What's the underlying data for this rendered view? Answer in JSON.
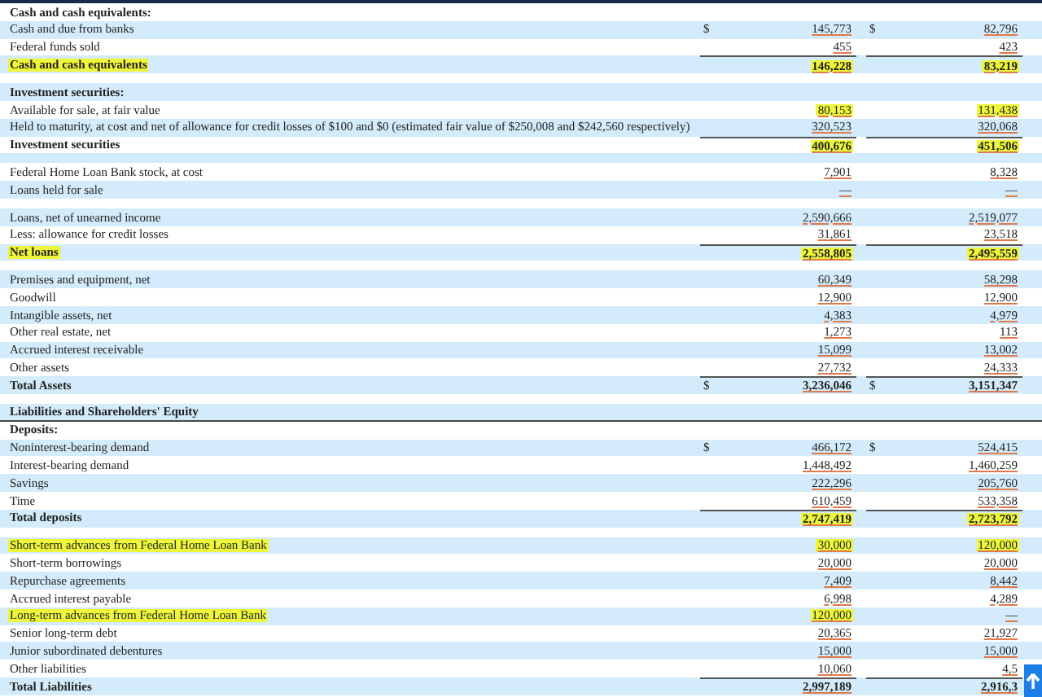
{
  "rows": [
    {
      "kind": "heading",
      "label": "Cash and cash equivalents:",
      "highlight": false
    },
    {
      "kind": "item",
      "label": "Cash and due from banks",
      "highlight": false,
      "col_1": {
        "dollar": "$",
        "value": "145,773",
        "highlight": false
      },
      "col_2": {
        "dollar": "$",
        "value": "82,796",
        "highlight": false
      }
    },
    {
      "kind": "item",
      "label": "Federal funds sold",
      "highlight": false,
      "col_1": {
        "value": "455",
        "highlight": false
      },
      "col_2": {
        "value": "423",
        "highlight": false
      }
    },
    {
      "kind": "total",
      "label": "Cash and cash equivalents",
      "highlight": true,
      "col_1": {
        "value": "146,228",
        "highlight": true
      },
      "col_2": {
        "value": "83,219",
        "highlight": true
      }
    },
    {
      "kind": "spacer"
    },
    {
      "kind": "heading",
      "label": "Investment securities:",
      "highlight": false
    },
    {
      "kind": "item",
      "label": "Available for sale, at fair value",
      "highlight": false,
      "col_1": {
        "value": "80,153",
        "highlight": true
      },
      "col_2": {
        "value": "131,438",
        "highlight": true
      }
    },
    {
      "kind": "item",
      "label": "Held to maturity, at cost and net of allowance for credit losses of $100 and $0 (estimated fair value of $250,008 and $242,560 respectively)",
      "highlight": false,
      "col_1": {
        "value": "320,523",
        "highlight": false
      },
      "col_2": {
        "value": "320,068",
        "highlight": false
      }
    },
    {
      "kind": "total",
      "label": "Investment securities",
      "highlight": false,
      "col_1": {
        "value": "400,676",
        "highlight": true
      },
      "col_2": {
        "value": "451,506",
        "highlight": true
      }
    },
    {
      "kind": "spacer"
    },
    {
      "kind": "item",
      "label": "Federal Home Loan Bank stock, at cost",
      "highlight": false,
      "col_1": {
        "value": "7,901",
        "highlight": false
      },
      "col_2": {
        "value": "8,328",
        "highlight": false
      }
    },
    {
      "kind": "item",
      "label": "Loans held for sale",
      "highlight": false,
      "col_1": {
        "value": "—",
        "highlight": false
      },
      "col_2": {
        "value": "—",
        "highlight": false
      }
    },
    {
      "kind": "spacer"
    },
    {
      "kind": "item",
      "label": "Loans, net of unearned income",
      "highlight": false,
      "col_1": {
        "value": "2,590,666",
        "highlight": false
      },
      "col_2": {
        "value": "2,519,077",
        "highlight": false
      }
    },
    {
      "kind": "item",
      "label": "Less: allowance for credit losses",
      "highlight": false,
      "col_1": {
        "value": "31,861",
        "highlight": false
      },
      "col_2": {
        "value": "23,518",
        "highlight": false
      }
    },
    {
      "kind": "total",
      "label": "Net loans",
      "highlight": true,
      "col_1": {
        "value": "2,558,805",
        "highlight": true
      },
      "col_2": {
        "value": "2,495,559",
        "highlight": true
      }
    },
    {
      "kind": "spacer"
    },
    {
      "kind": "item",
      "label": "Premises and equipment, net",
      "highlight": false,
      "col_1": {
        "value": "60,349",
        "highlight": false
      },
      "col_2": {
        "value": "58,298",
        "highlight": false
      }
    },
    {
      "kind": "item",
      "label": "Goodwill",
      "highlight": false,
      "col_1": {
        "value": "12,900",
        "highlight": false
      },
      "col_2": {
        "value": "12,900",
        "highlight": false
      }
    },
    {
      "kind": "item",
      "label": "Intangible assets, net",
      "highlight": false,
      "col_1": {
        "value": "4,383",
        "highlight": false
      },
      "col_2": {
        "value": "4,979",
        "highlight": false
      }
    },
    {
      "kind": "item",
      "label": "Other real estate, net",
      "highlight": false,
      "col_1": {
        "value": "1,273",
        "highlight": false
      },
      "col_2": {
        "value": "113",
        "highlight": false
      }
    },
    {
      "kind": "item",
      "label": "Accrued interest receivable",
      "highlight": false,
      "col_1": {
        "value": "15,099",
        "highlight": false
      },
      "col_2": {
        "value": "13,002",
        "highlight": false
      }
    },
    {
      "kind": "item",
      "label": "Other assets",
      "highlight": false,
      "col_1": {
        "value": "27,732",
        "highlight": false
      },
      "col_2": {
        "value": "24,333",
        "highlight": false
      }
    },
    {
      "kind": "total",
      "label": "Total Assets",
      "highlight": false,
      "col_1": {
        "dollar": "$",
        "value": "3,236,046",
        "highlight": false
      },
      "col_2": {
        "dollar": "$",
        "value": "3,151,347",
        "highlight": false
      }
    },
    {
      "kind": "spacer"
    },
    {
      "kind": "section",
      "label": "Liabilities and Shareholders' Equity",
      "highlight": false
    },
    {
      "kind": "heading",
      "label": "Deposits:",
      "highlight": false
    },
    {
      "kind": "item",
      "label": "Noninterest-bearing demand",
      "highlight": false,
      "col_1": {
        "dollar": "$",
        "value": "466,172",
        "highlight": false
      },
      "col_2": {
        "dollar": "$",
        "value": "524,415",
        "highlight": false
      }
    },
    {
      "kind": "item",
      "label": "Interest-bearing demand",
      "highlight": false,
      "col_1": {
        "value": "1,448,492",
        "highlight": false
      },
      "col_2": {
        "value": "1,460,259",
        "highlight": false
      }
    },
    {
      "kind": "item",
      "label": "Savings",
      "highlight": false,
      "col_1": {
        "value": "222,296",
        "highlight": false
      },
      "col_2": {
        "value": "205,760",
        "highlight": false
      }
    },
    {
      "kind": "item",
      "label": "Time",
      "highlight": false,
      "col_1": {
        "value": "610,459",
        "highlight": false
      },
      "col_2": {
        "value": "533,358",
        "highlight": false
      }
    },
    {
      "kind": "total",
      "label": "Total deposits",
      "highlight": false,
      "col_1": {
        "value": "2,747,419",
        "highlight": true
      },
      "col_2": {
        "value": "2,723,792",
        "highlight": true
      }
    },
    {
      "kind": "spacer"
    },
    {
      "kind": "item",
      "label": "Short-term advances from Federal Home Loan Bank",
      "highlight": true,
      "col_1": {
        "value": "30,000",
        "highlight": true
      },
      "col_2": {
        "value": "120,000",
        "highlight": true
      }
    },
    {
      "kind": "item",
      "label": "Short-term borrowings",
      "highlight": false,
      "col_1": {
        "value": "20,000",
        "highlight": false
      },
      "col_2": {
        "value": "20,000",
        "highlight": false
      }
    },
    {
      "kind": "item",
      "label": "Repurchase agreements",
      "highlight": false,
      "col_1": {
        "value": "7,409",
        "highlight": false
      },
      "col_2": {
        "value": "8,442",
        "highlight": false
      }
    },
    {
      "kind": "item",
      "label": "Accrued interest payable",
      "highlight": false,
      "col_1": {
        "value": "6,998",
        "highlight": false
      },
      "col_2": {
        "value": "4,289",
        "highlight": false
      }
    },
    {
      "kind": "item",
      "label": "Long-term advances from Federal Home Loan Bank",
      "highlight": true,
      "col_1": {
        "value": "120,000",
        "highlight": true
      },
      "col_2": {
        "value": "—",
        "highlight": false
      }
    },
    {
      "kind": "item",
      "label": "Senior long-term debt",
      "highlight": false,
      "col_1": {
        "value": "20,365",
        "highlight": false
      },
      "col_2": {
        "value": "21,927",
        "highlight": false
      }
    },
    {
      "kind": "item",
      "label": "Junior subordinated debentures",
      "highlight": false,
      "col_1": {
        "value": "15,000",
        "highlight": false
      },
      "col_2": {
        "value": "15,000",
        "highlight": false
      }
    },
    {
      "kind": "item",
      "label": "Other liabilities",
      "highlight": false,
      "col_1": {
        "value": "10,060",
        "highlight": false
      },
      "col_2": {
        "value": "4,5",
        "highlight": false
      }
    },
    {
      "kind": "total",
      "label": "Total Liabilities",
      "highlight": false,
      "col_1": {
        "value": "2,997,189",
        "highlight": false
      },
      "col_2": {
        "value": "2,916,3",
        "highlight": false
      }
    }
  ]
}
